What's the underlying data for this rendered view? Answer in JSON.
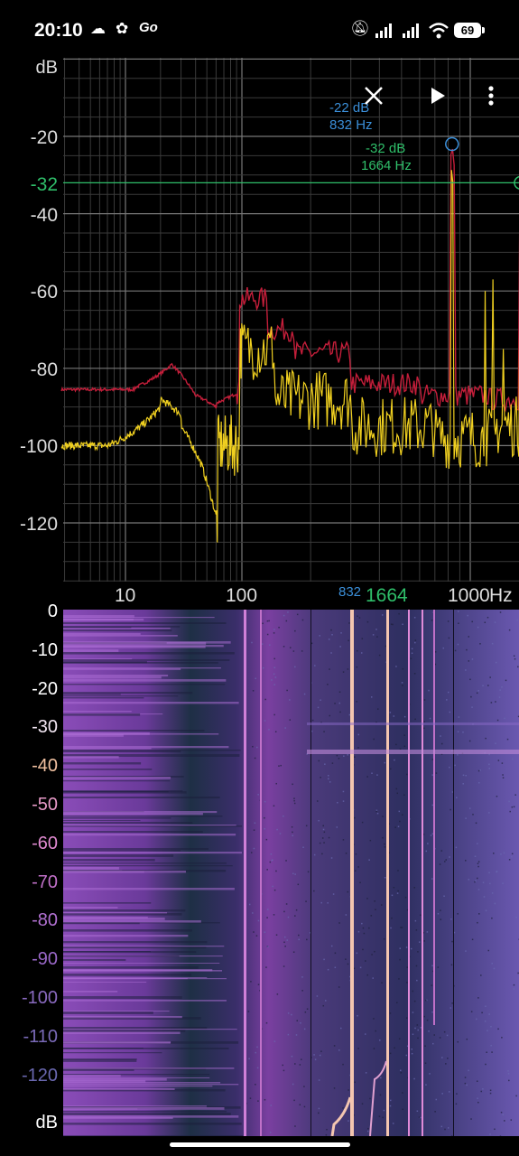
{
  "status": {
    "time": "20:10",
    "notif_icons": [
      "cloud-icon",
      "flower-icon",
      "go-icon"
    ],
    "battery": "69"
  },
  "spectrum": {
    "y_unit": "dB",
    "y_ticks": [
      "-20",
      "-40",
      "-60",
      "-80",
      "-100",
      "-120"
    ],
    "x_ticks": [
      "10",
      "100",
      "1000"
    ],
    "x_unit": "Hz",
    "cursor": {
      "db_label": "-32",
      "freq_label_1": "832",
      "freq_label_2": "1664"
    },
    "peak1": {
      "db": "-22 dB",
      "freq": "832 Hz"
    },
    "peak2": {
      "db": "-32 dB",
      "freq": "1664 Hz"
    },
    "colors": {
      "peak_trace": "#c41e3a",
      "live_trace": "#f0d020",
      "cursor": "#2fbf6a",
      "peak_marker": "#3b8fd9"
    }
  },
  "toolbar": {
    "close_icon": "close-icon",
    "play_icon": "play-icon",
    "menu_icon": "more-vert-icon"
  },
  "spectrogram": {
    "y_ticks": [
      "0",
      "-10",
      "-20",
      "-30",
      "-40",
      "-50",
      "-60",
      "-70",
      "-80",
      "-90",
      "-100",
      "-110",
      "-120"
    ],
    "y_unit": "dB",
    "colors": {
      "bg": "#2a2c5a",
      "mid": "#7a3fa0",
      "hot": "#f4c6b0"
    }
  }
}
